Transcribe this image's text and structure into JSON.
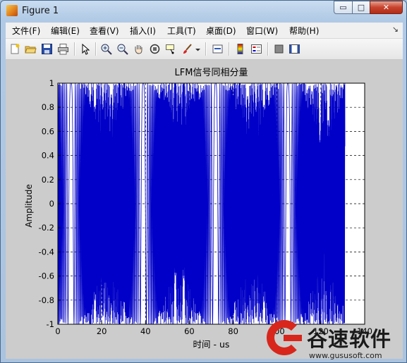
{
  "window": {
    "title": "Figure 1",
    "controls": {
      "minimize": "▭",
      "maximize": "□",
      "close": "✕"
    }
  },
  "menubar": {
    "items": [
      "文件(F)",
      "编辑(E)",
      "查看(V)",
      "插入(I)",
      "工具(T)",
      "桌面(D)",
      "窗口(W)",
      "帮助(H)"
    ],
    "more": "↘"
  },
  "toolbar": {
    "buttons": [
      "new-figure-icon",
      "open-file-icon",
      "save-icon",
      "print-icon",
      "pointer-icon",
      "zoom-in-icon",
      "zoom-out-icon",
      "pan-hand-icon",
      "rotate-3d-icon",
      "data-cursor-icon",
      "brush-icon",
      "dropdown-arrow-icon",
      "link-plot-icon",
      "colorbar-icon",
      "legend-icon",
      "hide-plot-tools-icon",
      "show-plot-tools-icon"
    ]
  },
  "chart_data": {
    "type": "line",
    "title": "LFM信号同相分量",
    "xlabel": "时间 - us",
    "ylabel": "Amplitude",
    "xlim": [
      0,
      140
    ],
    "ylim": [
      -1,
      1
    ],
    "xticks": [
      0,
      20,
      40,
      60,
      80,
      100,
      120,
      140
    ],
    "yticks": [
      -1,
      -0.8,
      -0.6,
      -0.4,
      -0.2,
      0,
      0.2,
      0.4,
      0.6,
      0.8,
      1
    ],
    "xtick_labels": [
      "0",
      "20",
      "40",
      "60",
      "80",
      "100",
      "120",
      "140"
    ],
    "ytick_labels": [
      "-1",
      "-0.8",
      "-0.6",
      "-0.4",
      "-0.2",
      "0",
      "0.2",
      "0.4",
      "0.6",
      "0.8",
      "1"
    ],
    "grid": true,
    "line_color": "#0000c8",
    "signal": {
      "description_free": true,
      "x_start": 0,
      "x_end": 131,
      "period": 33,
      "envelope_centers": [
        6,
        39,
        72,
        105
      ],
      "amplitude": 1
    }
  },
  "watermark": {
    "text": "谷速软件",
    "url": "www.gususoft.com",
    "color": "#d8261c"
  }
}
